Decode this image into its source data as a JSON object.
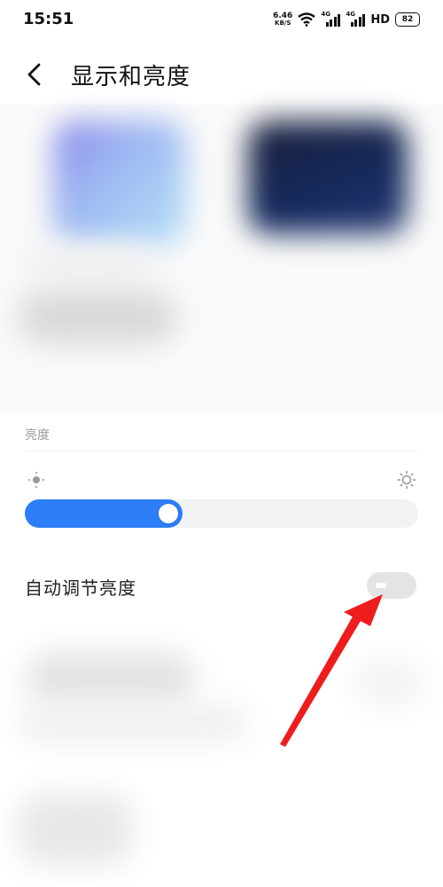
{
  "status_bar": {
    "time": "15:51",
    "net_speed_value": "6.46",
    "net_speed_unit": "KB/S",
    "signal1_tag": "4G",
    "signal2_tag": "4G",
    "hd_label": "HD",
    "battery": "82"
  },
  "header": {
    "title": "显示和亮度"
  },
  "brightness": {
    "section_label": "亮度",
    "level_percent": 40
  },
  "auto_brightness": {
    "label": "自动调节亮度",
    "enabled": false
  },
  "colors": {
    "accent": "#2d7df6",
    "arrow": "#ee1c1c",
    "toggle_off": "#e4e4e4"
  }
}
